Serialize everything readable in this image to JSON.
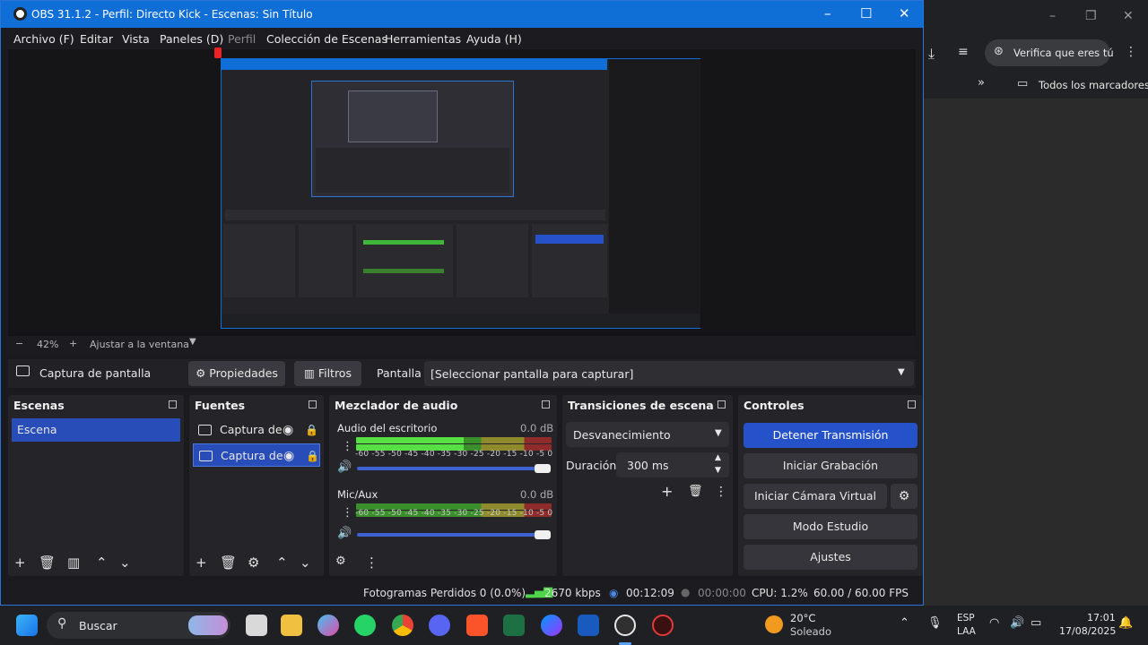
{
  "window": {
    "title": "OBS 31.1.2 - Perfil: Directo Kick - Escenas: Sin Título",
    "minimize": "–",
    "maximize": "☐",
    "close": "✕"
  },
  "menu": [
    "Archivo (F)",
    "Editar",
    "Vista",
    "Paneles (D)",
    "Perfil",
    "Colección de Escenas",
    "Herramientas",
    "Ayuda (H)"
  ],
  "browser": {
    "verify_label": "Verifica que eres tú",
    "bookmarks_label": "Todos los marcadores"
  },
  "zoom": {
    "minus": "−",
    "value": "42%",
    "plus": "+",
    "fit": "Ajustar a la ventana"
  },
  "source_bar": {
    "source_name": "Captura de pantalla",
    "properties": "Propiedades",
    "filters": "Filtros",
    "screen_label": "Pantalla",
    "screen_value": "[Seleccionar pantalla para capturar]"
  },
  "scenes": {
    "title": "Escenas",
    "items": [
      "Escena"
    ]
  },
  "sources": {
    "title": "Fuentes",
    "items": [
      "Captura de",
      "Captura de"
    ]
  },
  "mixer": {
    "title": "Mezclador de audio",
    "ticks": "-60 -55 -50 -45 -40 -35 -30 -25 -20 -15 -10 -5 0",
    "channels": [
      {
        "name": "Audio del escritorio",
        "db": "0.0 dB",
        "level": 0.55
      },
      {
        "name": "Mic/Aux",
        "db": "0.0 dB",
        "level": 0.0
      }
    ]
  },
  "transitions": {
    "title": "Transiciones de escena",
    "selected": "Desvanecimiento",
    "duration_label": "Duración",
    "duration_value": "300 ms"
  },
  "controls": {
    "title": "Controles",
    "stop_stream": "Detener Transmisión",
    "start_recording": "Iniciar Grabación",
    "start_virtual_cam": "Iniciar Cámara Virtual",
    "studio_mode": "Modo Estudio",
    "settings": "Ajustes"
  },
  "status": {
    "dropped": "Fotogramas Perdidos 0 (0.0%)",
    "bitrate": "2670 kbps",
    "stream_time": "00:12:09",
    "rec_time": "00:00:00",
    "cpu": "CPU: 1.2%",
    "fps": "60.00 / 60.00 FPS"
  },
  "taskbar": {
    "search": "Buscar",
    "weather_temp": "20°C",
    "weather_desc": "Soleado",
    "lang_top": "ESP",
    "lang_bottom": "LAA",
    "time": "17:01",
    "date": "17/08/2025"
  },
  "colors": {
    "accent": "#0f6fd6",
    "selection": "#284cb8",
    "stream_btn": "#2552c8"
  }
}
